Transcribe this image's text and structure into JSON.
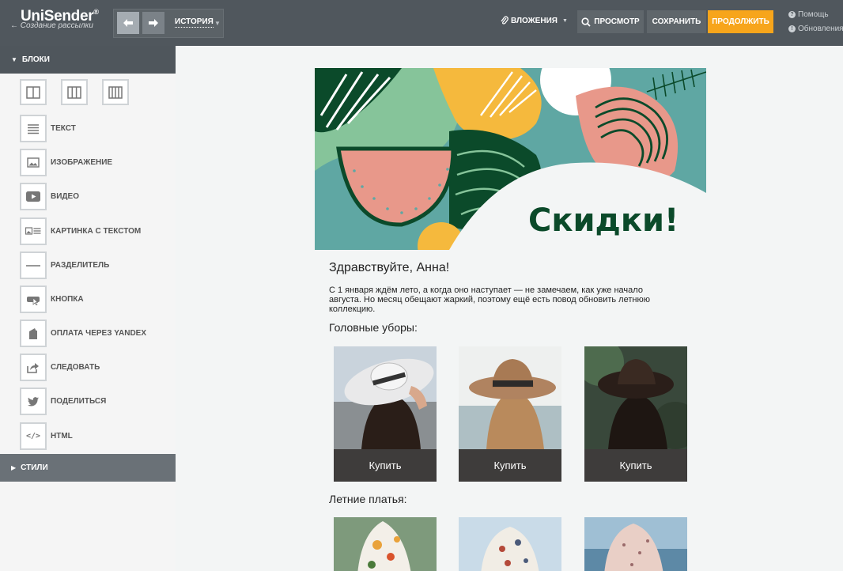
{
  "header": {
    "logo": "UniSender",
    "logo_mark": "®",
    "subtitle": "Создание рассылки",
    "history_label": "ИСТОРИЯ",
    "attachments_label": "ВЛОЖЕНИЯ",
    "preview_label": "ПРОСМОТР",
    "save_label": "СОХРАНИТЬ",
    "continue_label": "ПРОДОЛЖИТЬ",
    "help_label": "Помощь",
    "updates_label": "Обновления"
  },
  "sidebar": {
    "blocks_title": "БЛОКИ",
    "styles_title": "СТИЛИ",
    "items": [
      {
        "label": "ТЕКСТ",
        "icon": "text-icon"
      },
      {
        "label": "ИЗОБРАЖЕНИЕ",
        "icon": "image-icon"
      },
      {
        "label": "ВИДЕО",
        "icon": "video-icon"
      },
      {
        "label": "КАРТИНКА С ТЕКСТОМ",
        "icon": "image-text-icon"
      },
      {
        "label": "РАЗДЕЛИТЕЛЬ",
        "icon": "divider-icon"
      },
      {
        "label": "КНОПКА",
        "icon": "button-icon"
      },
      {
        "label": "ОПЛАТА ЧЕРЕЗ YANDEX",
        "icon": "wallet-icon"
      },
      {
        "label": "СЛЕДОВАТЬ",
        "icon": "share-icon"
      },
      {
        "label": "ПОДЕЛИТЬСЯ",
        "icon": "twitter-icon"
      },
      {
        "label": "HTML",
        "icon": "code-icon"
      }
    ]
  },
  "email": {
    "banner_text": "Скидки!",
    "greeting": "Здравствуйте, Анна!",
    "intro": "С 1 января ждём лето, а когда оно наступает — не замечаем, как уже начало августа. Но месяц обещают жаркий, поэтому ещё есть повод обновить летнюю коллекцию.",
    "section_hats": "Головные уборы:",
    "section_dresses": "Летние платья:",
    "products": [
      {
        "buy_label": "Купить"
      },
      {
        "buy_label": "Купить"
      },
      {
        "buy_label": "Купить"
      }
    ]
  },
  "colors": {
    "topbar": "#50575d",
    "accent": "#f7a51b",
    "banner_green": "#86c49a",
    "banner_dark": "#0b4a2a",
    "banner_pink": "#e8988a",
    "banner_yellow": "#f5b93d"
  }
}
